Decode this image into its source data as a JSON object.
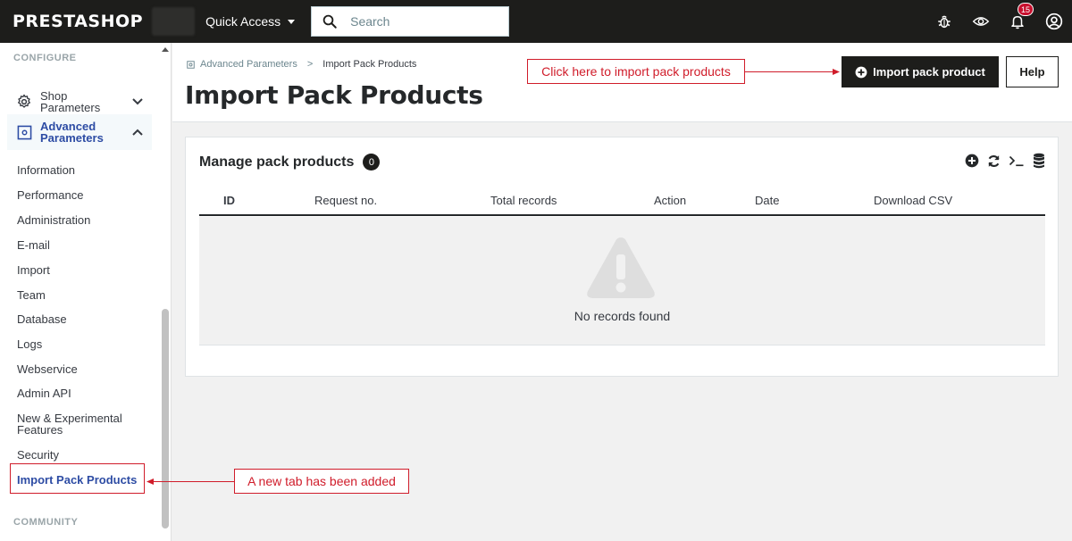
{
  "topbar": {
    "logo": "PRESTASHOP",
    "quick_access": "Quick Access",
    "search_placeholder": "Search",
    "notification_count": "15"
  },
  "sidebar": {
    "section_configure": "CONFIGURE",
    "shop_parameters": "Shop Parameters",
    "advanced_parameters": "Advanced Parameters",
    "items": [
      "Information",
      "Performance",
      "Administration",
      "E-mail",
      "Import",
      "Team",
      "Database",
      "Logs",
      "Webservice",
      "Admin API",
      "New & Experimental Features",
      "Security",
      "Import Pack Products"
    ],
    "section_community": "COMMUNITY"
  },
  "header": {
    "breadcrumb_parent": "Advanced Parameters",
    "breadcrumb_sep": ">",
    "breadcrumb_current": "Import Pack Products",
    "title": "Import Pack Products",
    "import_button": "Import pack product",
    "help_button": "Help"
  },
  "annotations": {
    "import_hint": "Click here to import pack products",
    "tab_hint": "A new tab has been added"
  },
  "card": {
    "title": "Manage pack products",
    "count": "0",
    "columns": [
      "ID",
      "Request no.",
      "Total records",
      "Action",
      "Date",
      "Download CSV"
    ],
    "empty_message": "No records found"
  },
  "colors": {
    "topbar": "#1d1d1b",
    "active_menu": "#2d4ca4",
    "annotation": "#d01c2a"
  }
}
